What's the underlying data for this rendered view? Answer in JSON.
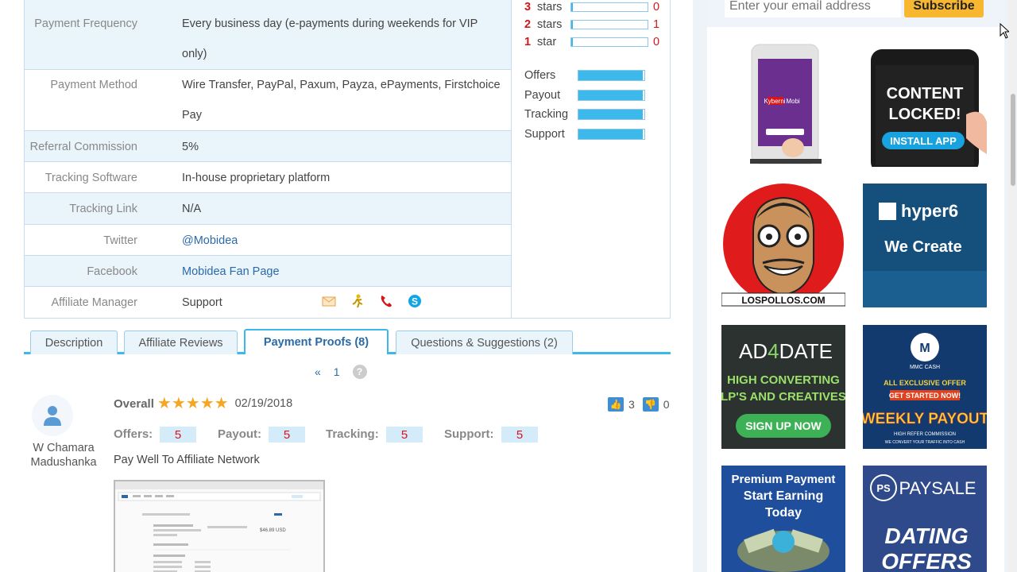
{
  "details": [
    {
      "label": "Payment Frequency",
      "lines": [
        "Every business day (e-payments during weekends for VIP",
        "only)"
      ],
      "link": false,
      "alt": true
    },
    {
      "label": "Payment Method",
      "lines": [
        "Wire Transfer, PayPal, Paxum, Payza, ePayments, Firstchoice",
        "Pay"
      ],
      "link": false,
      "alt": false
    },
    {
      "label": "Referral Commission",
      "lines": [
        "5%"
      ],
      "link": false,
      "alt": true
    },
    {
      "label": "Tracking Software",
      "lines": [
        "In-house proprietary platform"
      ],
      "link": false,
      "alt": false
    },
    {
      "label": "Tracking Link",
      "lines": [
        "N/A"
      ],
      "link": false,
      "alt": true
    },
    {
      "label": "Twitter",
      "lines": [
        "@Mobidea"
      ],
      "link": true,
      "alt": false
    },
    {
      "label": "Facebook",
      "lines": [
        "Mobidea Fan Page"
      ],
      "link": true,
      "alt": true
    },
    {
      "label": "Affiliate Manager",
      "lines": [
        "Support"
      ],
      "link": false,
      "alt": false
    }
  ],
  "contact_icons": [
    "email-icon",
    "aim-icon",
    "phone-icon",
    "skype-icon"
  ],
  "star_breakdown": [
    {
      "num": "3",
      "label": "stars",
      "count": "0",
      "fill": 0.02
    },
    {
      "num": "2",
      "label": "stars",
      "count": "1",
      "fill": 0.02
    },
    {
      "num": "1",
      "label": "star",
      "count": "0",
      "fill": 0.02
    }
  ],
  "category_ratings": [
    {
      "label": "Offers",
      "fill": 0.98
    },
    {
      "label": "Payout",
      "fill": 0.98
    },
    {
      "label": "Tracking",
      "fill": 0.98
    },
    {
      "label": "Support",
      "fill": 0.98
    }
  ],
  "tabs": [
    {
      "label": "Description",
      "active": false
    },
    {
      "label": "Affiliate Reviews",
      "active": false
    },
    {
      "label": "Payment Proofs (8)",
      "active": true
    },
    {
      "label": "Questions & Suggestions (2)",
      "active": false
    }
  ],
  "pager": {
    "prev": "«",
    "current": "1",
    "help": "?"
  },
  "review": {
    "reviewer": "W Chamara Madushanka",
    "overall_label": "Overall",
    "stars": 5,
    "date": "02/19/2018",
    "upvotes": "3",
    "downvotes": "0",
    "scores": [
      {
        "label": "Offers:",
        "value": "5"
      },
      {
        "label": "Payout:",
        "value": "5"
      },
      {
        "label": "Tracking:",
        "value": "5"
      },
      {
        "label": "Support:",
        "value": "5"
      }
    ],
    "title": "Pay Well To Affiliate Network",
    "proof_amount": "$46.89 USD"
  },
  "sidebar": {
    "email_placeholder": "Enter your email address",
    "subscribe_label": "Subscribe",
    "ads": {
      "kyberni": {
        "brand": "Kyberni",
        "sub": "Mobi"
      },
      "content_locked": {
        "line1": "CONTENT",
        "line2": "LOCKED!",
        "button": "INSTALL APP"
      },
      "lospollos": {
        "caption": "LOSPOLLOS.COM"
      },
      "hyper6": {
        "brand": "hyper6",
        "tagline": "We Create"
      },
      "ad4date": {
        "brand_a": "AD",
        "brand_4": "4",
        "brand_b": "DATE",
        "line1": "HIGH CONVERTING",
        "line2": "LP'S AND CREATIVES",
        "button": "SIGN UP NOW"
      },
      "mmc": {
        "brand": "MMC CASH",
        "offer": "ALL EXCLUSIVE OFFER",
        "start": "GET STARTED NOW!",
        "weekly": "WEEKLY PAYOUT",
        "refer": "HIGH REFER COMMISSION",
        "convert": "WE CONVERT YOUR TRAFFIC INTO CASH"
      },
      "premium": {
        "line1": "Premium Payment",
        "line2": "Start Earning",
        "line3": "Today"
      },
      "paysale": {
        "brand": "PAYSALE",
        "line1": "DATING",
        "line2": "OFFERS"
      }
    }
  },
  "colors": {
    "accent": "#3cb8ea",
    "link": "#2b6aa8",
    "red": "#d8141b",
    "star": "#f5a623",
    "subscribe": "#f7b731"
  }
}
